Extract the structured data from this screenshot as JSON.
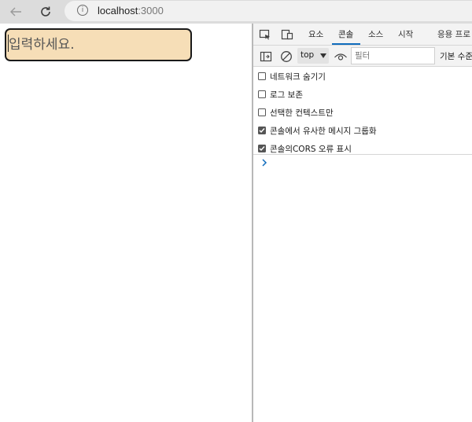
{
  "browser": {
    "url_host": "localhost",
    "url_port": ":3000",
    "info_glyph": "i"
  },
  "page": {
    "input_placeholder": "입력하세요.",
    "input_value": ""
  },
  "devtools": {
    "tabs": [
      "요소",
      "콘솔",
      "소스",
      "시작",
      "응용 프로"
    ],
    "active_tab": "콘솔",
    "context": "top",
    "filter_placeholder": "필터",
    "levels_label": "기본 수준",
    "options": [
      {
        "label": "네트워크 숨기기",
        "checked": false
      },
      {
        "label": "로그 보존",
        "checked": false
      },
      {
        "label": "선택한 컨텍스트만",
        "checked": false
      },
      {
        "label": "콘솔에서 유사한 메시지 그룹화",
        "checked": true
      },
      {
        "label": "콘솔의CORS 오류 표시",
        "checked": true
      }
    ],
    "accent_color": "#0f6cbd"
  }
}
